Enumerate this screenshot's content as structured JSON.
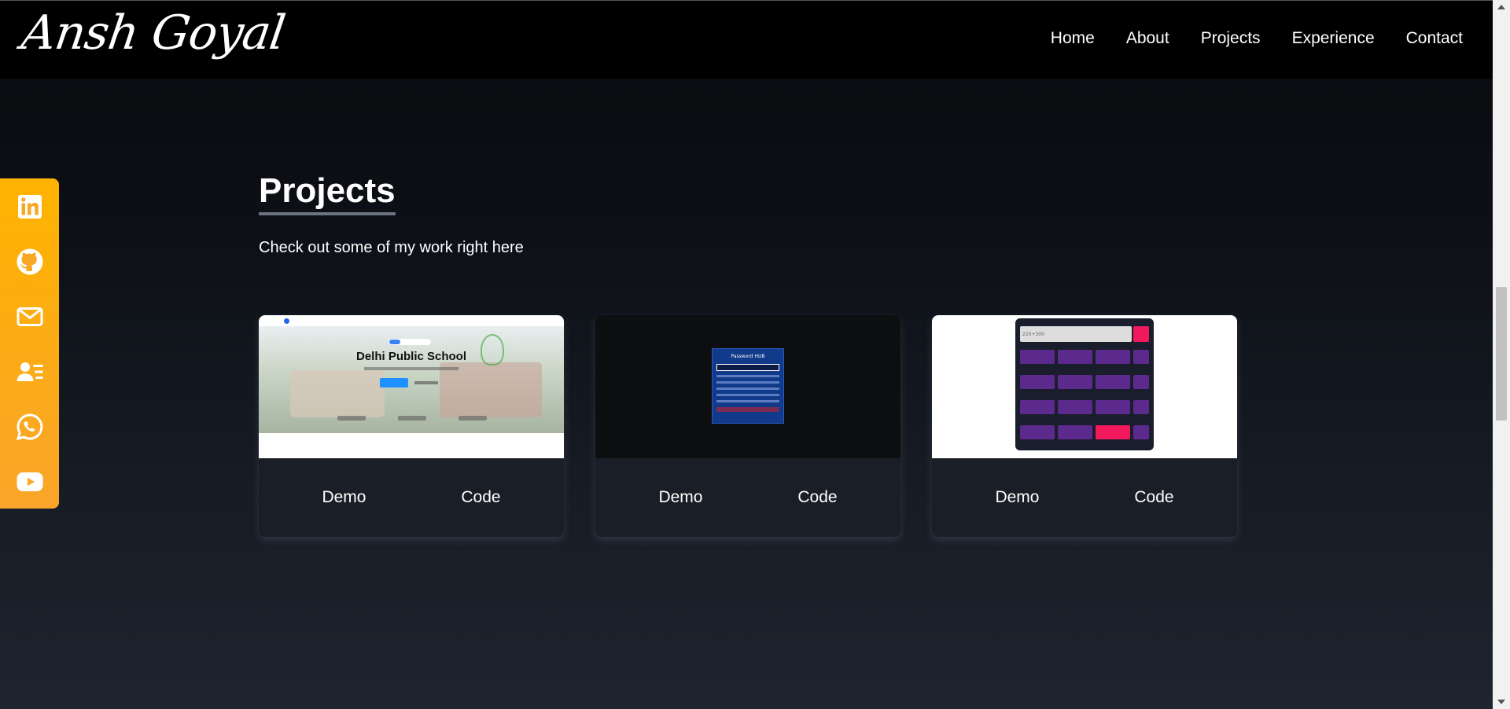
{
  "brand": {
    "name": "Ansh Goyal"
  },
  "nav": {
    "items": [
      {
        "label": "Home"
      },
      {
        "label": "About"
      },
      {
        "label": "Projects"
      },
      {
        "label": "Experience"
      },
      {
        "label": "Contact"
      }
    ]
  },
  "social": {
    "items": [
      {
        "icon": "linkedin-icon"
      },
      {
        "icon": "github-icon"
      },
      {
        "icon": "mail-icon"
      },
      {
        "icon": "contact-card-icon"
      },
      {
        "icon": "whatsapp-icon"
      },
      {
        "icon": "youtube-icon"
      }
    ],
    "bar_color": "#ffb300"
  },
  "projects": {
    "title": "Projects",
    "subtitle": "Check out some of my work right here",
    "cards": [
      {
        "thumb_title": "Delhi Public School",
        "demo_label": "Demo",
        "code_label": "Code"
      },
      {
        "thumb_title": "Password HUB",
        "demo_label": "Demo",
        "code_label": "Code"
      },
      {
        "thumb_title": "220+300",
        "demo_label": "Demo",
        "code_label": "Code"
      }
    ]
  }
}
